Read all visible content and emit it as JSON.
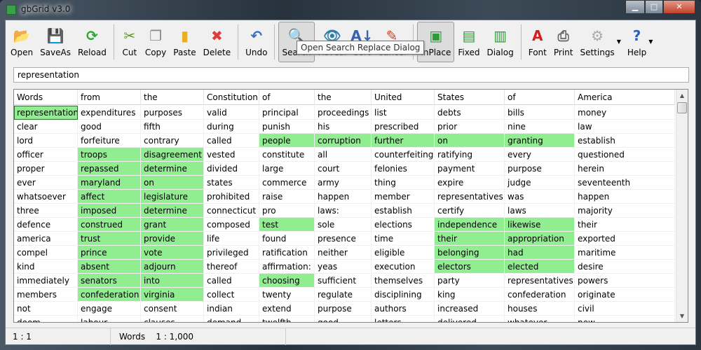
{
  "window": {
    "title": "gbGrid   v3.0",
    "minimize": "▁",
    "maximize": "□",
    "close": "✕"
  },
  "toolbar": {
    "groups": [
      [
        {
          "label": "Open",
          "icon": "folder-open-icon",
          "glyph": "📂",
          "color": "#e8b040"
        },
        {
          "label": "SaveAs",
          "icon": "floppy-disk-icon",
          "glyph": "💾",
          "color": "#4a7fc0"
        },
        {
          "label": "Reload",
          "icon": "reload-icon",
          "glyph": "⟳",
          "color": "#2fa82f"
        }
      ],
      [
        {
          "label": "Cut",
          "icon": "scissors-icon",
          "glyph": "✂",
          "color": "#5a9a2a"
        },
        {
          "label": "Copy",
          "icon": "copy-icon",
          "glyph": "❐",
          "color": "#888"
        },
        {
          "label": "Paste",
          "icon": "clipboard-icon",
          "glyph": "▮",
          "color": "#e8b020"
        },
        {
          "label": "Delete",
          "icon": "delete-x-icon",
          "glyph": "✖",
          "color": "#e03a3a"
        }
      ],
      [
        {
          "label": "Undo",
          "icon": "undo-icon",
          "glyph": "↶",
          "color": "#3a70c0"
        }
      ],
      [
        {
          "label": "Search",
          "icon": "search-magnifier-icon",
          "glyph": "🔍",
          "color": "#e0a020",
          "active": true
        },
        {
          "label": "Reveal",
          "icon": "eye-icon",
          "glyph": "👁",
          "color": "#2a7fb0"
        },
        {
          "label": "Sort",
          "icon": "sort-az-icon",
          "glyph": "A↓",
          "color": "#3a60b0"
        },
        {
          "label": "Cancel",
          "icon": "cancel-edit-icon",
          "glyph": "✎",
          "color": "#d04020"
        }
      ],
      [
        {
          "label": "InPlace",
          "icon": "grid-inplace-icon",
          "glyph": "▣",
          "color": "#2f9a3a",
          "active": true
        },
        {
          "label": "Fixed",
          "icon": "grid-fixed-icon",
          "glyph": "▤",
          "color": "#2f9a3a"
        },
        {
          "label": "Dialog",
          "icon": "grid-dialog-icon",
          "glyph": "▥",
          "color": "#2f9a3a"
        }
      ],
      [
        {
          "label": "Font",
          "icon": "font-icon",
          "glyph": "A",
          "color": "#d02020"
        },
        {
          "label": "Print",
          "icon": "printer-icon",
          "glyph": "⎙",
          "color": "#666"
        },
        {
          "label": "Settings",
          "icon": "gear-icon",
          "glyph": "⚙",
          "color": "#aaa",
          "dropdown": true
        },
        {
          "label": "Help",
          "icon": "help-icon",
          "glyph": "?",
          "color": "#2a60c0",
          "dropdown": true
        }
      ]
    ],
    "tooltip": "Open Search  Replace Dialog"
  },
  "search": {
    "value": "representation"
  },
  "grid": {
    "headers": [
      "Words",
      "from",
      "the",
      "Constitution",
      "of",
      "the",
      "United",
      "States",
      "of",
      "America"
    ],
    "highlight_color": "#90ee90",
    "rows": [
      {
        "cells": [
          "representation",
          "expenditures",
          "purposes",
          "valid",
          "principal",
          "proceedings",
          "list",
          "debts",
          "bills",
          "money"
        ],
        "hl": [
          0
        ]
      },
      {
        "cells": [
          "clear",
          "good",
          "fifth",
          "during",
          "punish",
          "his",
          "prescribed",
          "prior",
          "nine",
          "law"
        ],
        "hl": []
      },
      {
        "cells": [
          "lord",
          "forfeiture",
          "contrary",
          "called",
          "people",
          "corruption",
          "further",
          "on",
          "granting",
          "establish"
        ],
        "hl": [
          4,
          5,
          6,
          7,
          8
        ]
      },
      {
        "cells": [
          "officer",
          "troops",
          "disagreement",
          "vested",
          "constitute",
          "all",
          "counterfeiting",
          "ratifying",
          "every",
          "questioned"
        ],
        "hl": [
          1,
          2
        ]
      },
      {
        "cells": [
          "proper",
          "repassed",
          "determine",
          "divided",
          "large",
          "court",
          "felonies",
          "payment",
          "purpose",
          "herein"
        ],
        "hl": [
          1,
          2
        ]
      },
      {
        "cells": [
          "ever",
          "maryland",
          "on",
          "states",
          "commerce",
          "army",
          "thing",
          "expire",
          "judge",
          "seventeenth"
        ],
        "hl": [
          1,
          2
        ]
      },
      {
        "cells": [
          "whatsoever",
          "affect",
          "legislature",
          "prohibited",
          "raise",
          "happen",
          "member",
          "representatives",
          "was",
          "happen"
        ],
        "hl": [
          1,
          2
        ]
      },
      {
        "cells": [
          "three",
          "imposed",
          "determine",
          "connecticut",
          "pro",
          "laws:",
          "establish",
          "certify",
          "laws",
          "majority"
        ],
        "hl": [
          1,
          2
        ]
      },
      {
        "cells": [
          "defence",
          "construed",
          "grant",
          "composed",
          "test",
          "sole",
          "elections",
          "independence",
          "likewise",
          "their"
        ],
        "hl": [
          1,
          2,
          4,
          7,
          8
        ]
      },
      {
        "cells": [
          "america",
          "trust",
          "provide",
          "life",
          "found",
          "presence",
          "time",
          "their",
          "appropriation",
          "exported"
        ],
        "hl": [
          1,
          2,
          7,
          8
        ]
      },
      {
        "cells": [
          "compel",
          "prince",
          "vote",
          "privileged",
          "ratification",
          "neither",
          "eligible",
          "belonging",
          "had",
          "maritime"
        ],
        "hl": [
          1,
          2,
          7,
          8
        ]
      },
      {
        "cells": [
          "kind",
          "absent",
          "adjourn",
          "thereof",
          "affirmation:",
          "yeas",
          "execution",
          "electors",
          "elected",
          "desire"
        ],
        "hl": [
          1,
          2,
          7,
          8
        ]
      },
      {
        "cells": [
          "immediately",
          "senators",
          "into",
          "called",
          "choosing",
          "sufficient",
          "themselves",
          "party",
          "representatives",
          "powers"
        ],
        "hl": [
          1,
          2,
          4
        ]
      },
      {
        "cells": [
          "members",
          "confederation",
          "virginia",
          "collect",
          "twenty",
          "regulate",
          "disciplining",
          "king",
          "confederation",
          "originate"
        ],
        "hl": [
          1,
          2
        ]
      },
      {
        "cells": [
          "not",
          "engage",
          "consent",
          "indian",
          "extend",
          "purpose",
          "authors",
          "increased",
          "houses",
          "civil"
        ],
        "hl": []
      },
      {
        "cells": [
          "doom",
          "labour",
          "clauses",
          "demand",
          "twelfth",
          "good",
          "letters",
          "delivered",
          "whatever",
          "new"
        ],
        "hl": []
      }
    ]
  },
  "status": {
    "position": "1 : 1",
    "column": "Words",
    "range": "1 : 1,000"
  }
}
